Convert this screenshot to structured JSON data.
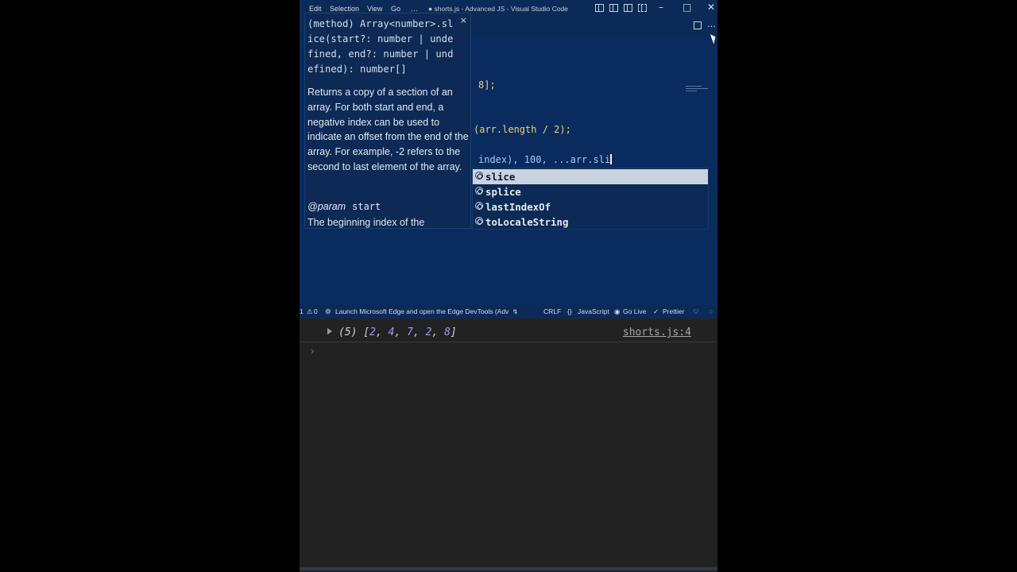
{
  "titlebar": {
    "menu": [
      "Edit",
      "Selection",
      "View",
      "Go",
      "…"
    ],
    "title": "● shorts.js - Advanced JS - Visual Studio Code",
    "window_controls": [
      "–",
      "□",
      "✕"
    ]
  },
  "editor": {
    "toolbar_more": "…",
    "lines": [
      {
        "text": "8];"
      },
      {
        "text": "(arr.length / 2);"
      },
      {
        "text": "index), 100, ...arr.sli"
      }
    ]
  },
  "hover": {
    "signature": "(method) Array<number>.sl\nice(start?: number | unde\nfined, end?: number | und\nefined): number[]",
    "close": "×",
    "description": "Returns a copy of a section of an array. For both start and end, a negative index can be used to indicate an offset from the end of the array. For example, -2 refers to the second to last element of the array.",
    "param_tag": "@param",
    "param_name": "start",
    "param_desc": "The beginning index of the"
  },
  "suggest": {
    "items": [
      {
        "label": "slice",
        "selected": true
      },
      {
        "label": "splice",
        "selected": false
      },
      {
        "label": "lastIndexOf",
        "selected": false
      },
      {
        "label": "toLocaleString",
        "selected": false
      }
    ]
  },
  "statusbar": {
    "left_num": "1",
    "problems": "0",
    "launch": "Launch Microsoft Edge and open the Edge DevTools (Adv",
    "eol": "CRLF",
    "language": "JavaScript",
    "golive": "Go Live",
    "prettier": "Prettier"
  },
  "console": {
    "count": "(5)",
    "array_open": "[",
    "values": [
      "2",
      "4",
      "7",
      "2",
      "8"
    ],
    "array_close": "]",
    "source": "shorts.js:4",
    "prompt": "›"
  },
  "colors": {
    "editor_bg": "#0a2b5d",
    "console_bg": "#222222",
    "suggest_selected": "#c9d2de"
  }
}
